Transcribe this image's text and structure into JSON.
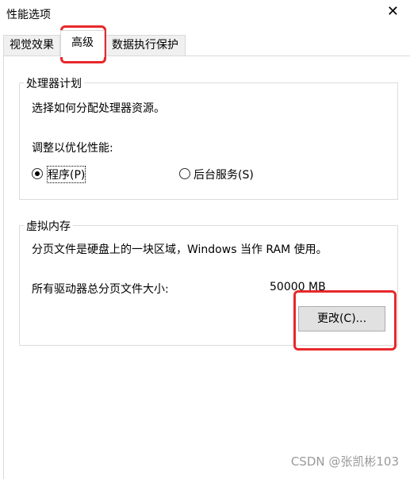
{
  "window": {
    "title": "性能选项",
    "close_glyph": "✕"
  },
  "tabs": [
    {
      "label": "视觉效果",
      "active": false
    },
    {
      "label": "高级",
      "active": true
    },
    {
      "label": "数据执行保护",
      "active": false
    }
  ],
  "processor": {
    "legend": "处理器计划",
    "description": "选择如何分配处理器资源。",
    "optimize_label": "调整以优化性能:",
    "options": [
      {
        "label": "程序(P)",
        "checked": true
      },
      {
        "label": "后台服务(S)",
        "checked": false
      }
    ]
  },
  "virtual_memory": {
    "legend": "虚拟内存",
    "description": "分页文件是硬盘上的一块区域，Windows 当作 RAM 使用。",
    "total_label": "所有驱动器总分页文件大小:",
    "total_value": "50000 MB",
    "change_button": "更改(C)..."
  },
  "watermark": "CSDN @张凯彬103",
  "colors": {
    "annotation_red": "#e8282c"
  }
}
